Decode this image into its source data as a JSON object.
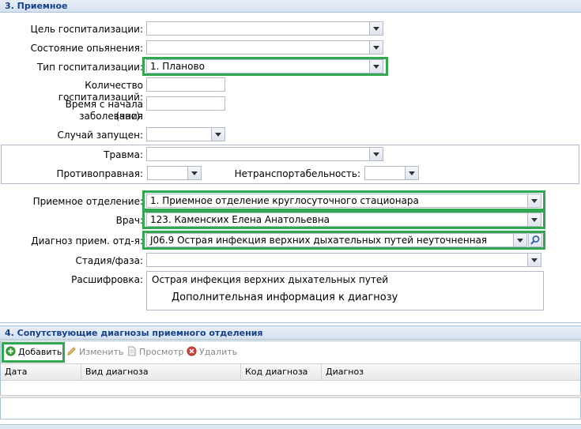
{
  "section3": {
    "title": "3. Приемное",
    "fields": {
      "goal": {
        "label": "Цель госпитализации:",
        "value": ""
      },
      "intox": {
        "label": "Состояние опьянения:",
        "value": ""
      },
      "type": {
        "label": "Тип госпитализации:",
        "value": "1. Планово"
      },
      "count": {
        "label": "Количество госпитализаций:",
        "value": ""
      },
      "time_line1": "Время с начала заболевания",
      "time_line2": "(час):",
      "late": {
        "label": "Случай запущен:",
        "value": ""
      },
      "trauma": {
        "label": "Травма:",
        "value": ""
      },
      "illegal": {
        "label": "Противоправная:",
        "value": ""
      },
      "nontransport": {
        "label": "Нетранспортабельность:",
        "value": ""
      },
      "dept": {
        "label": "Приемное отделение:",
        "value": "1. Приемное отделение круглосуточного стационара"
      },
      "doctor": {
        "label": "Врач:",
        "value": "123. Каменских Елена Анатольевна"
      },
      "diag": {
        "label": "Диагноз прием. отд-я:",
        "value": "J06.9 Острая инфекция верхних дыхательных путей неуточненная"
      },
      "stage": {
        "label": "Стадия/фаза:",
        "value": ""
      },
      "decode": {
        "label": "Расшифровка:",
        "value": "Острая инфекция верхних дыхательных путей"
      },
      "extra_info": "Дополнительная информация к диагнозу"
    }
  },
  "section4": {
    "title": "4. Сопутствующие диагнозы приемного отделения",
    "toolbar": {
      "add": "Добавить",
      "edit": "Изменить",
      "view": "Просмотр",
      "delete": "Удалить"
    },
    "columns": [
      "Дата",
      "Вид диагноза",
      "Код диагноза",
      "Диагноз"
    ]
  },
  "colors": {
    "highlight": "#2fa84f",
    "header_text": "#15428b",
    "border": "#b5b8c8"
  }
}
